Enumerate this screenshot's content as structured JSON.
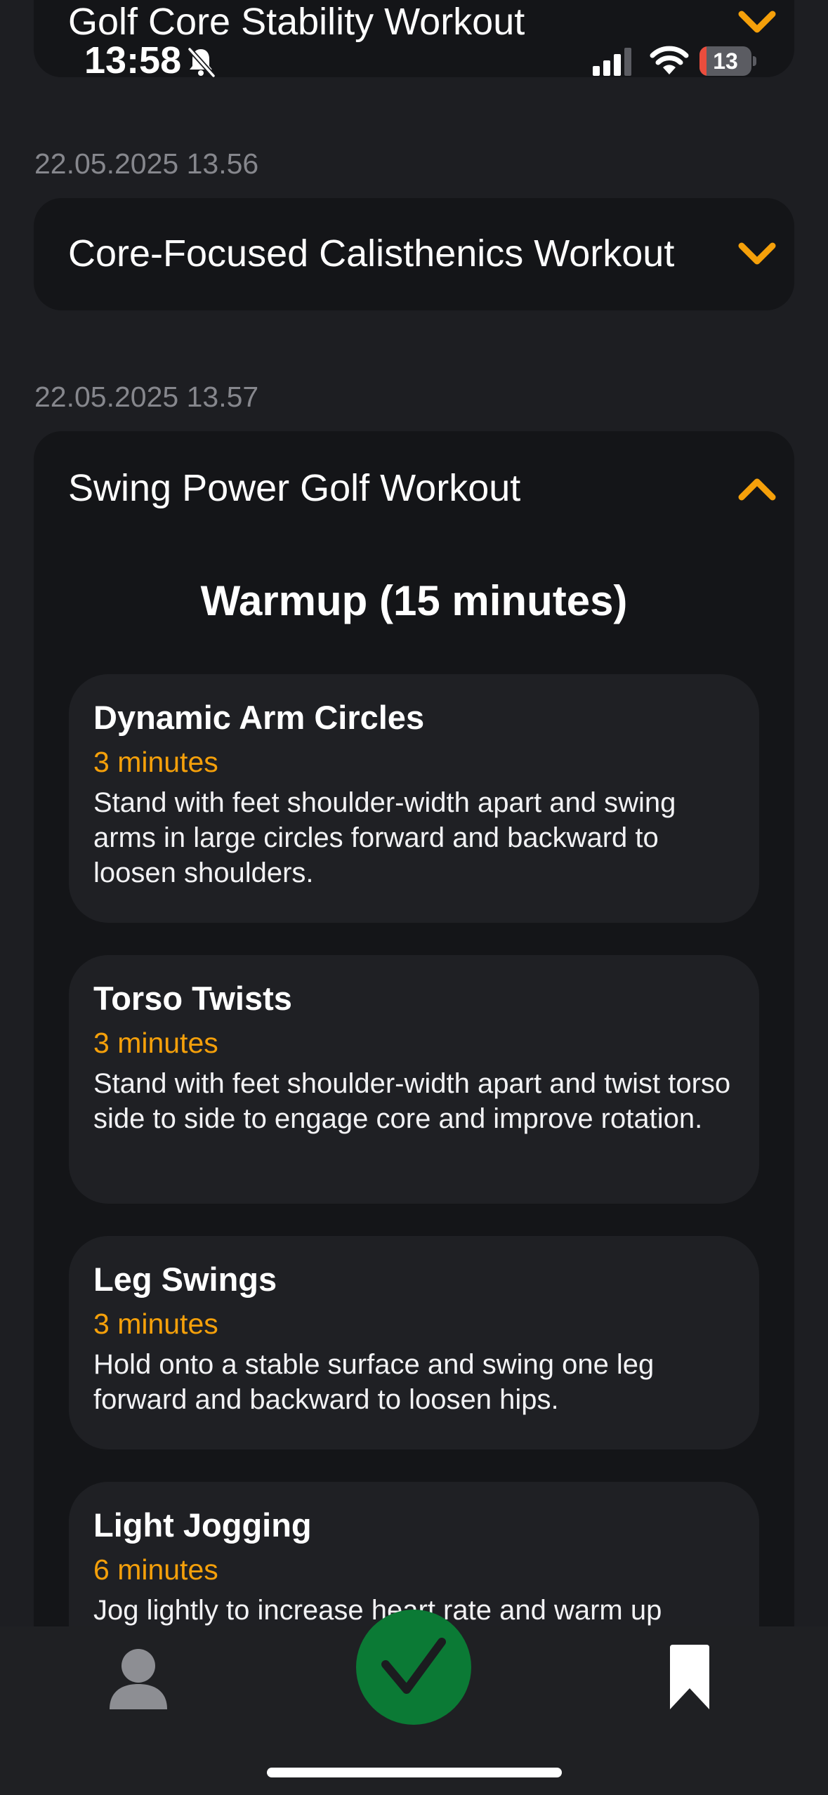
{
  "status_bar": {
    "time": "13:58",
    "battery_level": "13",
    "battery_fraction": 0.13
  },
  "entries": [
    {
      "title": "Golf Core Stability Workout",
      "expanded": false
    },
    {
      "timestamp": "22.05.2025 13.56",
      "title": "Core-Focused Calisthenics Workout",
      "expanded": false
    },
    {
      "timestamp": "22.05.2025 13.57",
      "title": "Swing Power Golf Workout",
      "expanded": true,
      "section": "Warmup (15 minutes)",
      "exercises": [
        {
          "name": "Dynamic Arm Circles",
          "duration": "3 minutes",
          "description": "Stand with feet shoulder-width apart and swing arms in large circles forward and backward to loosen shoulders."
        },
        {
          "name": "Torso Twists",
          "duration": "3 minutes",
          "description": "Stand with feet shoulder-width apart and twist torso side to side to engage core and improve rotation."
        },
        {
          "name": "Leg Swings",
          "duration": "3 minutes",
          "description": "Hold onto a stable surface and swing one leg forward and backward to loosen hips."
        },
        {
          "name": "Light Jogging",
          "duration": "6 minutes",
          "description": "Jog lightly to increase heart rate and warm up"
        }
      ]
    }
  ],
  "tab_bar": {
    "items": [
      "person-icon",
      "checkmark-icon",
      "bookmark-icon"
    ]
  },
  "colors": {
    "background": "#1d1e22",
    "card": "#141518",
    "exercise_card": "#1f2024",
    "accent": "#f5a00a",
    "timestamp": "#86878d",
    "done_button": "#0b7a35"
  }
}
